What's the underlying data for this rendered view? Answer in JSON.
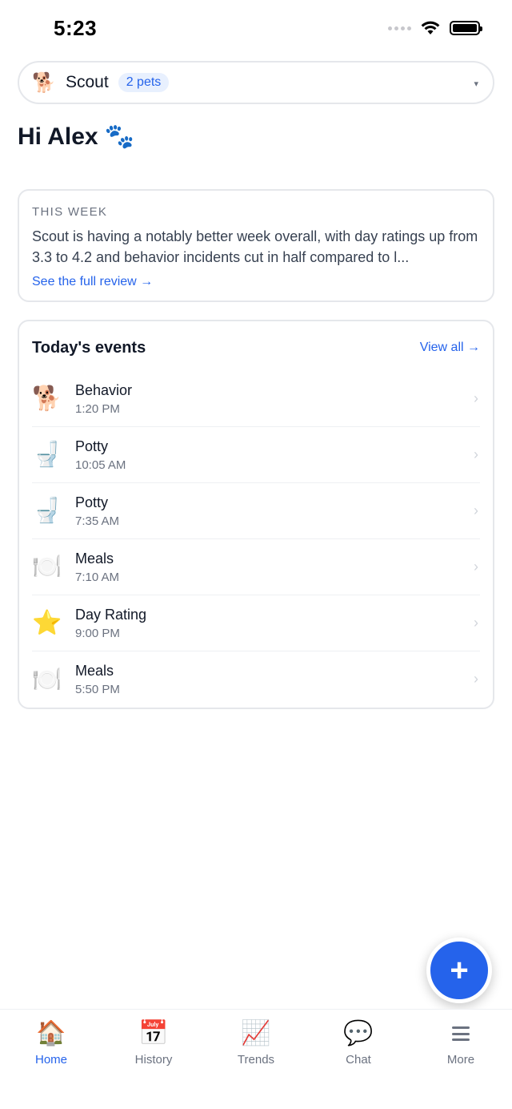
{
  "status_bar": {
    "time": "5:23"
  },
  "pet_selector": {
    "emoji": "🐕",
    "pet_name": "Scout",
    "pet_count": "2 pets",
    "caret": "▾"
  },
  "greeting": {
    "text": "Hi Alex",
    "paw": "🐾"
  },
  "week_card": {
    "heading": "THIS WEEK",
    "summary": "Scout is having a notably better week overall, with day ratings up from 3.3 to 4.2 and behavior incidents cut in half compared to l...",
    "link": "See the full review →"
  },
  "events_card": {
    "title": "Today's events",
    "view_all": "View all →",
    "items": [
      {
        "icon": "🐕",
        "title": "Behavior",
        "time": "1:20 PM"
      },
      {
        "icon": "🚽",
        "title": "Potty",
        "time": "10:05 AM"
      },
      {
        "icon": "🚽",
        "title": "Potty",
        "time": "7:35 AM"
      },
      {
        "icon": "🍽️",
        "title": "Meals",
        "time": "7:10 AM"
      },
      {
        "icon": "⭐",
        "title": "Day Rating",
        "time": "9:00 PM"
      },
      {
        "icon": "🍽️",
        "title": "Meals",
        "time": "5:50 PM"
      }
    ],
    "chevron": "›"
  },
  "fab": {
    "label": "+"
  },
  "tab_bar": {
    "tabs": [
      {
        "icon": "🏠",
        "label": "Home"
      },
      {
        "icon": "📅",
        "label": "History"
      },
      {
        "icon": "📈",
        "label": "Trends"
      },
      {
        "icon": "💬",
        "label": "Chat"
      },
      {
        "icon": "menu-icon",
        "label": "More"
      }
    ],
    "active": "Home"
  },
  "colors": {
    "accent": "#2563eb",
    "border": "#e5e7eb",
    "muted": "#6b7280"
  }
}
